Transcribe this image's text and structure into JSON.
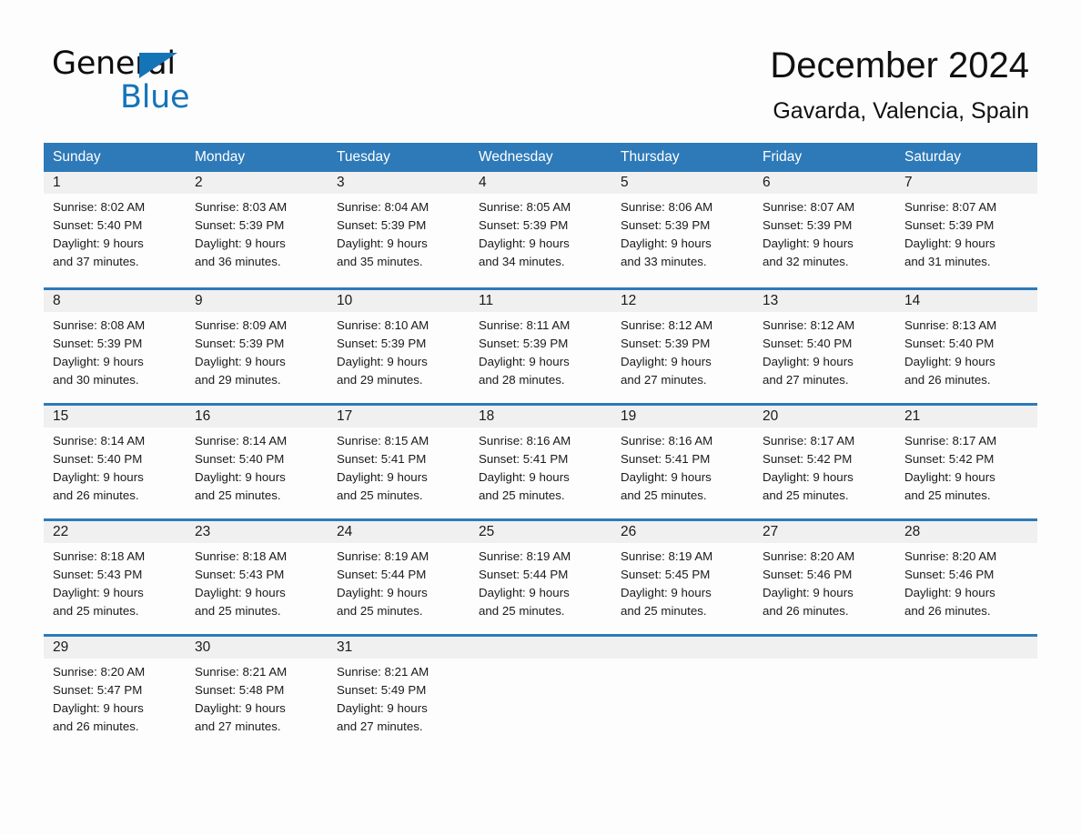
{
  "brand": {
    "name_part1": "General",
    "name_part2": "Blue",
    "accent_color": "#1574b8",
    "triangle_icon": "triangle-icon"
  },
  "header": {
    "title": "December 2024",
    "location": "Gavarda, Valencia, Spain"
  },
  "calendar": {
    "header_bg": "#2e7ab8",
    "row_rule_color": "#2e7ab8",
    "daynum_bg": "#f0f0f0",
    "weekdays": [
      "Sunday",
      "Monday",
      "Tuesday",
      "Wednesday",
      "Thursday",
      "Friday",
      "Saturday"
    ],
    "weeks": [
      [
        {
          "day": "1",
          "sunrise": "Sunrise: 8:02 AM",
          "sunset": "Sunset: 5:40 PM",
          "daylight1": "Daylight: 9 hours",
          "daylight2": "and 37 minutes."
        },
        {
          "day": "2",
          "sunrise": "Sunrise: 8:03 AM",
          "sunset": "Sunset: 5:39 PM",
          "daylight1": "Daylight: 9 hours",
          "daylight2": "and 36 minutes."
        },
        {
          "day": "3",
          "sunrise": "Sunrise: 8:04 AM",
          "sunset": "Sunset: 5:39 PM",
          "daylight1": "Daylight: 9 hours",
          "daylight2": "and 35 minutes."
        },
        {
          "day": "4",
          "sunrise": "Sunrise: 8:05 AM",
          "sunset": "Sunset: 5:39 PM",
          "daylight1": "Daylight: 9 hours",
          "daylight2": "and 34 minutes."
        },
        {
          "day": "5",
          "sunrise": "Sunrise: 8:06 AM",
          "sunset": "Sunset: 5:39 PM",
          "daylight1": "Daylight: 9 hours",
          "daylight2": "and 33 minutes."
        },
        {
          "day": "6",
          "sunrise": "Sunrise: 8:07 AM",
          "sunset": "Sunset: 5:39 PM",
          "daylight1": "Daylight: 9 hours",
          "daylight2": "and 32 minutes."
        },
        {
          "day": "7",
          "sunrise": "Sunrise: 8:07 AM",
          "sunset": "Sunset: 5:39 PM",
          "daylight1": "Daylight: 9 hours",
          "daylight2": "and 31 minutes."
        }
      ],
      [
        {
          "day": "8",
          "sunrise": "Sunrise: 8:08 AM",
          "sunset": "Sunset: 5:39 PM",
          "daylight1": "Daylight: 9 hours",
          "daylight2": "and 30 minutes."
        },
        {
          "day": "9",
          "sunrise": "Sunrise: 8:09 AM",
          "sunset": "Sunset: 5:39 PM",
          "daylight1": "Daylight: 9 hours",
          "daylight2": "and 29 minutes."
        },
        {
          "day": "10",
          "sunrise": "Sunrise: 8:10 AM",
          "sunset": "Sunset: 5:39 PM",
          "daylight1": "Daylight: 9 hours",
          "daylight2": "and 29 minutes."
        },
        {
          "day": "11",
          "sunrise": "Sunrise: 8:11 AM",
          "sunset": "Sunset: 5:39 PM",
          "daylight1": "Daylight: 9 hours",
          "daylight2": "and 28 minutes."
        },
        {
          "day": "12",
          "sunrise": "Sunrise: 8:12 AM",
          "sunset": "Sunset: 5:39 PM",
          "daylight1": "Daylight: 9 hours",
          "daylight2": "and 27 minutes."
        },
        {
          "day": "13",
          "sunrise": "Sunrise: 8:12 AM",
          "sunset": "Sunset: 5:40 PM",
          "daylight1": "Daylight: 9 hours",
          "daylight2": "and 27 minutes."
        },
        {
          "day": "14",
          "sunrise": "Sunrise: 8:13 AM",
          "sunset": "Sunset: 5:40 PM",
          "daylight1": "Daylight: 9 hours",
          "daylight2": "and 26 minutes."
        }
      ],
      [
        {
          "day": "15",
          "sunrise": "Sunrise: 8:14 AM",
          "sunset": "Sunset: 5:40 PM",
          "daylight1": "Daylight: 9 hours",
          "daylight2": "and 26 minutes."
        },
        {
          "day": "16",
          "sunrise": "Sunrise: 8:14 AM",
          "sunset": "Sunset: 5:40 PM",
          "daylight1": "Daylight: 9 hours",
          "daylight2": "and 25 minutes."
        },
        {
          "day": "17",
          "sunrise": "Sunrise: 8:15 AM",
          "sunset": "Sunset: 5:41 PM",
          "daylight1": "Daylight: 9 hours",
          "daylight2": "and 25 minutes."
        },
        {
          "day": "18",
          "sunrise": "Sunrise: 8:16 AM",
          "sunset": "Sunset: 5:41 PM",
          "daylight1": "Daylight: 9 hours",
          "daylight2": "and 25 minutes."
        },
        {
          "day": "19",
          "sunrise": "Sunrise: 8:16 AM",
          "sunset": "Sunset: 5:41 PM",
          "daylight1": "Daylight: 9 hours",
          "daylight2": "and 25 minutes."
        },
        {
          "day": "20",
          "sunrise": "Sunrise: 8:17 AM",
          "sunset": "Sunset: 5:42 PM",
          "daylight1": "Daylight: 9 hours",
          "daylight2": "and 25 minutes."
        },
        {
          "day": "21",
          "sunrise": "Sunrise: 8:17 AM",
          "sunset": "Sunset: 5:42 PM",
          "daylight1": "Daylight: 9 hours",
          "daylight2": "and 25 minutes."
        }
      ],
      [
        {
          "day": "22",
          "sunrise": "Sunrise: 8:18 AM",
          "sunset": "Sunset: 5:43 PM",
          "daylight1": "Daylight: 9 hours",
          "daylight2": "and 25 minutes."
        },
        {
          "day": "23",
          "sunrise": "Sunrise: 8:18 AM",
          "sunset": "Sunset: 5:43 PM",
          "daylight1": "Daylight: 9 hours",
          "daylight2": "and 25 minutes."
        },
        {
          "day": "24",
          "sunrise": "Sunrise: 8:19 AM",
          "sunset": "Sunset: 5:44 PM",
          "daylight1": "Daylight: 9 hours",
          "daylight2": "and 25 minutes."
        },
        {
          "day": "25",
          "sunrise": "Sunrise: 8:19 AM",
          "sunset": "Sunset: 5:44 PM",
          "daylight1": "Daylight: 9 hours",
          "daylight2": "and 25 minutes."
        },
        {
          "day": "26",
          "sunrise": "Sunrise: 8:19 AM",
          "sunset": "Sunset: 5:45 PM",
          "daylight1": "Daylight: 9 hours",
          "daylight2": "and 25 minutes."
        },
        {
          "day": "27",
          "sunrise": "Sunrise: 8:20 AM",
          "sunset": "Sunset: 5:46 PM",
          "daylight1": "Daylight: 9 hours",
          "daylight2": "and 26 minutes."
        },
        {
          "day": "28",
          "sunrise": "Sunrise: 8:20 AM",
          "sunset": "Sunset: 5:46 PM",
          "daylight1": "Daylight: 9 hours",
          "daylight2": "and 26 minutes."
        }
      ],
      [
        {
          "day": "29",
          "sunrise": "Sunrise: 8:20 AM",
          "sunset": "Sunset: 5:47 PM",
          "daylight1": "Daylight: 9 hours",
          "daylight2": "and 26 minutes."
        },
        {
          "day": "30",
          "sunrise": "Sunrise: 8:21 AM",
          "sunset": "Sunset: 5:48 PM",
          "daylight1": "Daylight: 9 hours",
          "daylight2": "and 27 minutes."
        },
        {
          "day": "31",
          "sunrise": "Sunrise: 8:21 AM",
          "sunset": "Sunset: 5:49 PM",
          "daylight1": "Daylight: 9 hours",
          "daylight2": "and 27 minutes."
        },
        {
          "day": "",
          "sunrise": "",
          "sunset": "",
          "daylight1": "",
          "daylight2": ""
        },
        {
          "day": "",
          "sunrise": "",
          "sunset": "",
          "daylight1": "",
          "daylight2": ""
        },
        {
          "day": "",
          "sunrise": "",
          "sunset": "",
          "daylight1": "",
          "daylight2": ""
        },
        {
          "day": "",
          "sunrise": "",
          "sunset": "",
          "daylight1": "",
          "daylight2": ""
        }
      ]
    ]
  }
}
